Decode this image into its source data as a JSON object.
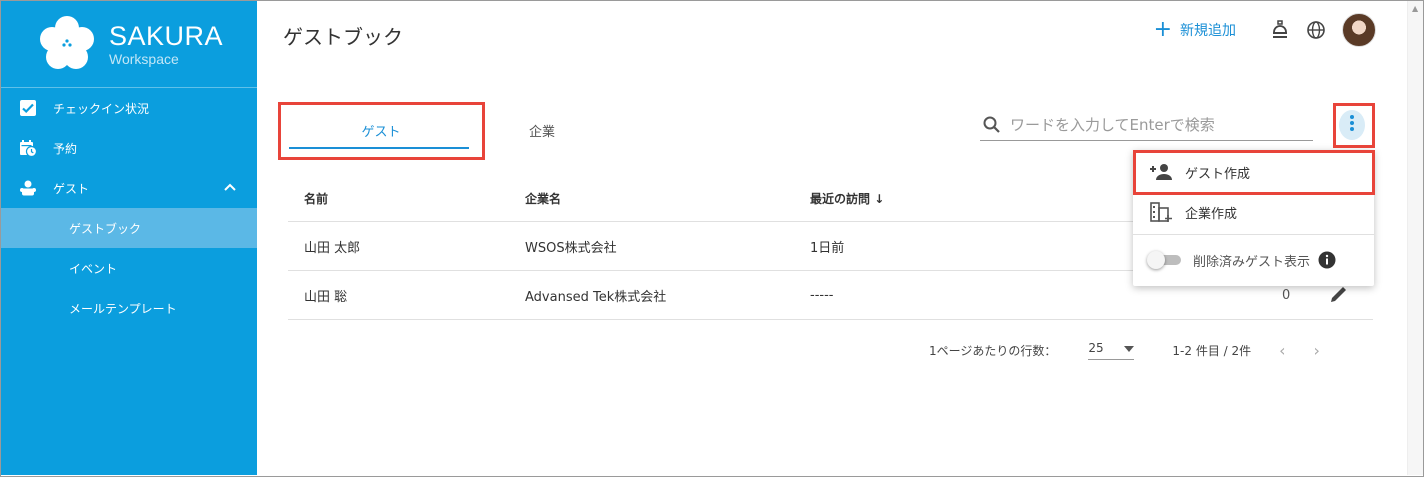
{
  "brand": {
    "name": "SAKURA",
    "sub": "Workspace"
  },
  "sidebar": {
    "items": [
      {
        "label": "チェックイン状況",
        "icon": "checkbox-icon"
      },
      {
        "label": "予約",
        "icon": "calendar-clock-icon"
      },
      {
        "label": "ゲスト",
        "icon": "people-icon",
        "expanded": true
      },
      {
        "label": "ゲストブック",
        "active": true
      },
      {
        "label": "イベント"
      },
      {
        "label": "メールテンプレート"
      }
    ]
  },
  "header": {
    "title": "ゲストブック",
    "add_label": "新規追加"
  },
  "tabs": [
    {
      "label": "ゲスト",
      "selected": true
    },
    {
      "label": "企業"
    }
  ],
  "search": {
    "placeholder": "ワードを入力してEnterで検索",
    "value": ""
  },
  "table": {
    "headers": [
      "名前",
      "企業名",
      "最近の訪問"
    ],
    "sort_indicator": "↓",
    "rows": [
      {
        "name": "山田 太郎",
        "company": "WSOS株式会社",
        "last_visit": "1日前",
        "count": ""
      },
      {
        "name": "山田 聡",
        "company": "Advansed Tek株式会社",
        "last_visit": "-----",
        "count": "0"
      }
    ]
  },
  "pagination": {
    "rows_per_page_label": "1ページあたりの行数：",
    "rows_per_page": "25",
    "range": "1-2 件目 / 2件",
    "prev": "‹",
    "next": "›"
  },
  "menu": {
    "items": [
      {
        "label": "ゲスト作成",
        "icon": "person-add-icon"
      },
      {
        "label": "企業作成",
        "icon": "domain-add-icon"
      }
    ],
    "toggle_label": "削除済みゲスト表示",
    "toggle_on": false
  },
  "colors": {
    "sidebar": "#0b9ede",
    "sidebar_active": "#5bb8e6",
    "accent": "#1a8fd6",
    "highlight": "#e8443a"
  }
}
